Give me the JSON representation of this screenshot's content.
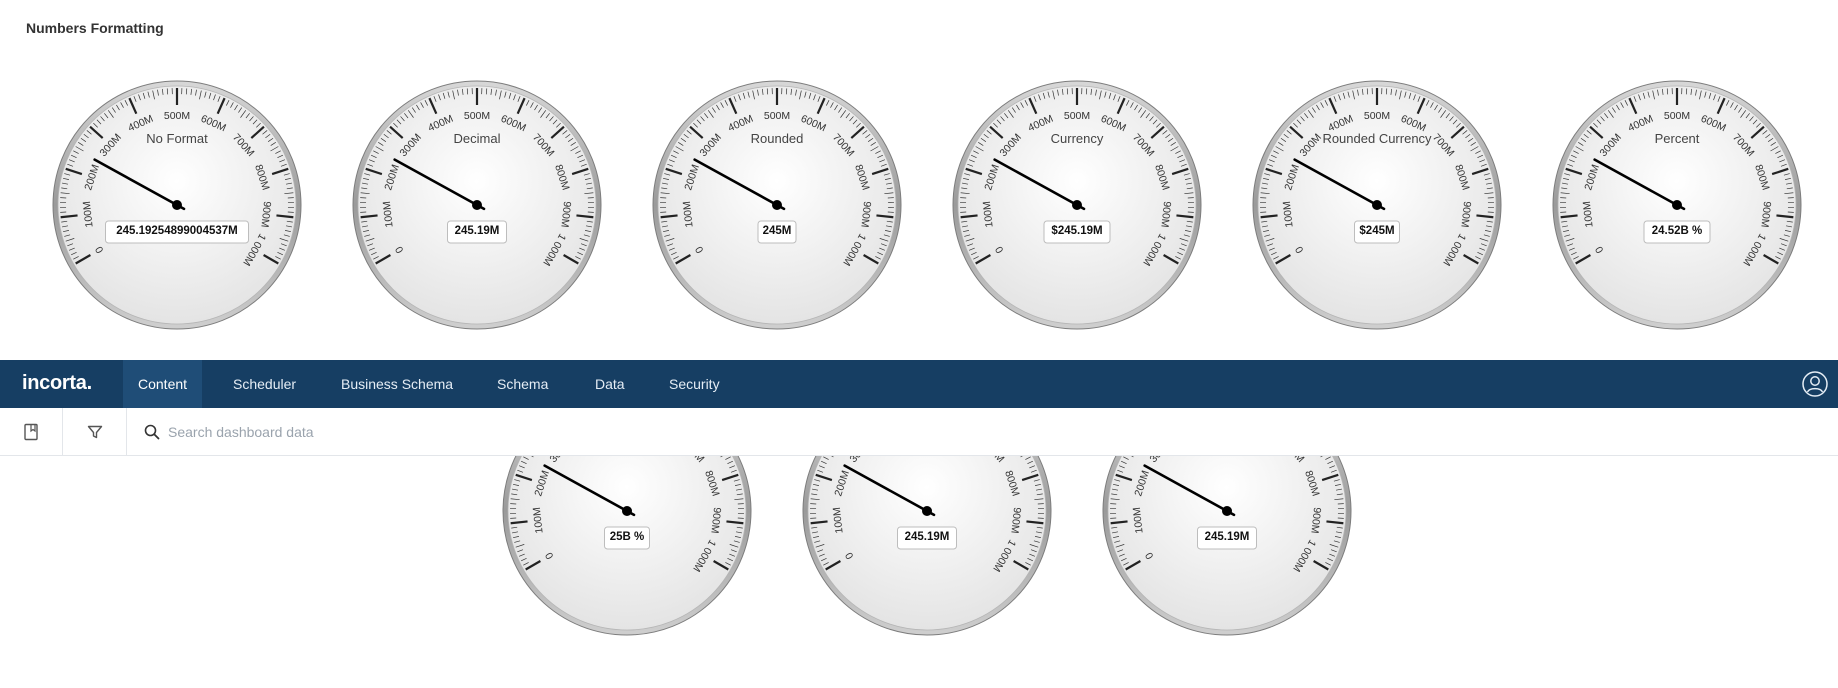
{
  "section_title": "Numbers Formatting",
  "scale": {
    "ticks": [
      {
        "value": 0,
        "label": "0"
      },
      {
        "value": 100,
        "label": "100M"
      },
      {
        "value": 200,
        "label": "200M"
      },
      {
        "value": 300,
        "label": "300M"
      },
      {
        "value": 400,
        "label": "400M"
      },
      {
        "value": 500,
        "label": "500M"
      },
      {
        "value": 600,
        "label": "600M"
      },
      {
        "value": 700,
        "label": "700M"
      },
      {
        "value": 800,
        "label": "800M"
      },
      {
        "value": 900,
        "label": "900M"
      },
      {
        "value": 1000,
        "label": "1 000M"
      }
    ]
  },
  "gauges": [
    {
      "title": "No Format",
      "value_label": "245.19254899004537M",
      "value": 245.19
    },
    {
      "title": "Decimal",
      "value_label": "245.19M",
      "value": 245.19
    },
    {
      "title": "Rounded",
      "value_label": "245M",
      "value": 245.19
    },
    {
      "title": "Currency",
      "value_label": "$245.19M",
      "value": 245.19
    },
    {
      "title": "Rounded Currency",
      "value_label": "$245M",
      "value": 245.19
    },
    {
      "title": "Percent",
      "value_label": "24.52B %",
      "value": 245.19
    },
    {
      "title": "",
      "value_label": "25B %",
      "value": 245.19
    },
    {
      "title": "",
      "value_label": "245.19M",
      "value": 245.19
    },
    {
      "title": "",
      "value_label": "245.19M",
      "value": 245.19
    }
  ],
  "navbar": {
    "logo": "incorta.",
    "tabs": [
      {
        "label": "Content",
        "active": true
      },
      {
        "label": "Scheduler",
        "active": false
      },
      {
        "label": "Business Schema",
        "active": false
      },
      {
        "label": "Schema",
        "active": false
      },
      {
        "label": "Data",
        "active": false
      },
      {
        "label": "Security",
        "active": false
      }
    ],
    "user_icon": "user-circle-icon"
  },
  "toolbar": {
    "bookmark_icon": "bookmark-icon",
    "filter_icon": "filter-icon",
    "search_icon": "search-icon",
    "search_placeholder": "Search dashboard data",
    "search_value": ""
  },
  "colors": {
    "navbar_bg": "#163e63",
    "navbar_active": "#1f4d77",
    "needle": "#000000"
  }
}
